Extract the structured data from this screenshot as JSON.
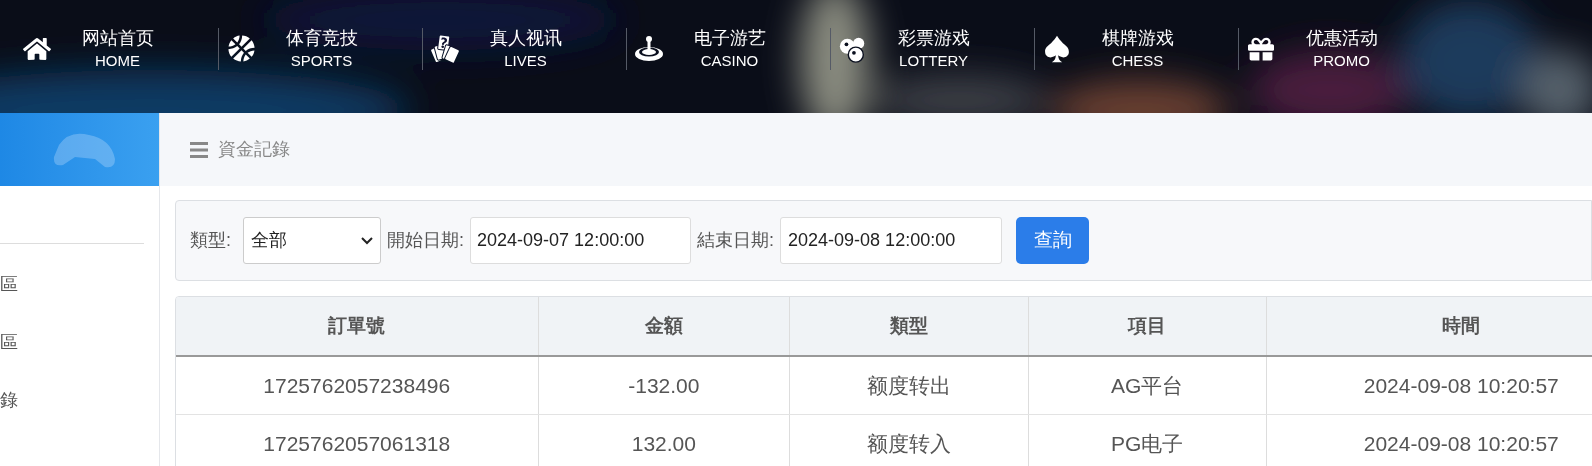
{
  "nav": [
    {
      "kind": "home",
      "title": "网站首页",
      "subtitle": "HOME"
    },
    {
      "kind": "sports",
      "title": "体育竞技",
      "subtitle": "SPORTS"
    },
    {
      "kind": "lives",
      "title": "真人视讯",
      "subtitle": "LIVES"
    },
    {
      "kind": "casino",
      "title": "电子游艺",
      "subtitle": "CASINO"
    },
    {
      "kind": "lottery",
      "title": "彩票游戏",
      "subtitle": "LOTTERY"
    },
    {
      "kind": "chess",
      "title": "棋牌游戏",
      "subtitle": "CHESS"
    },
    {
      "kind": "promo",
      "title": "优惠活动",
      "subtitle": "PROMO"
    }
  ],
  "sidebar": {
    "items": [
      "區",
      "區",
      "錄"
    ]
  },
  "breadcrumb": "資金記錄",
  "filter": {
    "type_label": "類型:",
    "type_value": "全部",
    "start_label": "開始日期:",
    "start_value": "2024-09-07 12:00:00",
    "end_label": "結束日期:",
    "end_value": "2024-09-08 12:00:00",
    "button": "查詢"
  },
  "table": {
    "columns": [
      "訂單號",
      "金額",
      "類型",
      "項目",
      "時間"
    ],
    "rows": [
      [
        "1725762057238496",
        "-132.00",
        "额度转出",
        "AG平台",
        "2024-09-08 10:20:57"
      ],
      [
        "1725762057061318",
        "132.00",
        "额度转入",
        "PG电子",
        "2024-09-08 10:20:57"
      ]
    ]
  }
}
